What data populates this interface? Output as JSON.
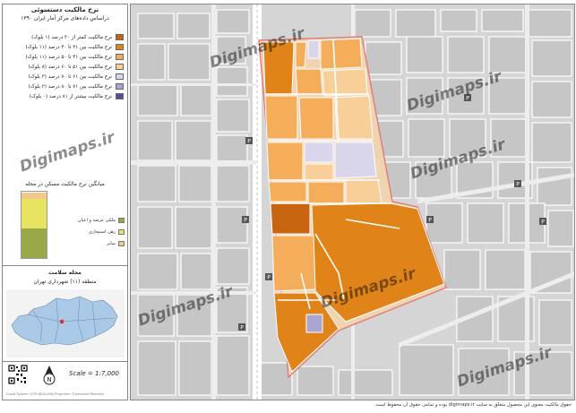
{
  "panel": {
    "title": "نرخ مالکیت دستسوئی",
    "subtitle": "دراساس داده‌های مرکز آمار ایران ۱۳۹۰"
  },
  "legend": [
    {
      "label": "نرخ مالکیت کمتر از ۳۰ درصد (۱ بلوک)",
      "color": "#c8640f"
    },
    {
      "label": "نرخ مالکیت بین ۳۱ تا ۴۰ درصد (۱۱ بلوک)",
      "color": "#e0841a"
    },
    {
      "label": "نرخ مالکیت بین ۴۱ تا ۵۰ درصد (۱۱ بلوک)",
      "color": "#f4ad5a"
    },
    {
      "label": "نرخ مالکیت بین ۵۱ تا ۶۰ درصد (۸ بلوک)",
      "color": "#f8cf98"
    },
    {
      "label": "نرخ مالکیت بین ۶۱ تا ۷۰ درصد (۳ بلوک)",
      "color": "#d9d6ec"
    },
    {
      "label": "نرخ مالکیت بین ۷۱ تا ۸۰ درصد (۲ بلوک)",
      "color": "#a9a4d2"
    },
    {
      "label": "نرخ مالکیت بیشتر از ۸۱ درصد (۰ بلوک)",
      "color": "#5c4a9c"
    }
  ],
  "bar_chart": {
    "title": "میانگین نرخ مالکیت مسکن در محله",
    "segments": [
      {
        "label": "ملکی عرصه و اعیان",
        "color": "#9aa84a",
        "share": 0.45
      },
      {
        "label": "رهن استیجاری",
        "color": "#e8e360",
        "share": 0.45
      },
      {
        "label": "سایر",
        "color": "#f4c88a",
        "share": 0.1
      }
    ]
  },
  "location": {
    "title": "محله سلامت",
    "subtitle": "منطقه (۱۱) شهرداری تهران"
  },
  "scale": "Scale = 1:7,000",
  "north_letter": "N",
  "footer_small": "Coord System: UTM WGS1984 Projection: Transverse Mercator",
  "watermark": "Digimaps.ir",
  "bottom_note": "حقوق مالکیت معنوی این محصول متعلق به سایت digimaps.ir بوده و تمامی حقوق آن محفوظ است.",
  "pois": [
    "P",
    "P",
    "P",
    "P",
    "P",
    "P",
    "P",
    "P"
  ]
}
